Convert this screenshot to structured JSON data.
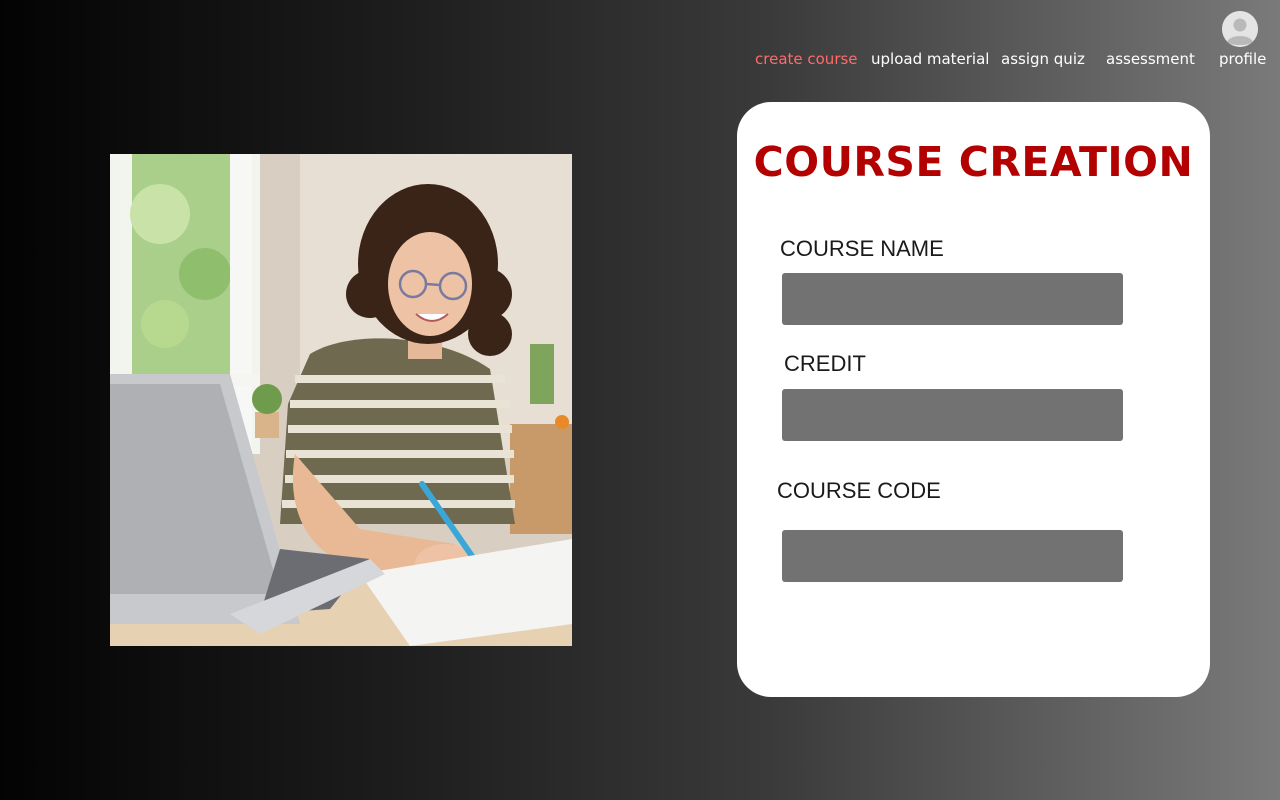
{
  "nav": {
    "items": [
      {
        "label": "create course",
        "active": true
      },
      {
        "label": "upload material",
        "active": false
      },
      {
        "label": "assign quiz",
        "active": false
      },
      {
        "label": "assessment",
        "active": false
      },
      {
        "label": "profile",
        "active": false
      }
    ]
  },
  "form": {
    "title": "COURSE CREATION",
    "fields": [
      {
        "label": "COURSE NAME",
        "value": ""
      },
      {
        "label": "CREDIT",
        "value": ""
      },
      {
        "label": "COURSE CODE",
        "value": ""
      }
    ]
  },
  "colors": {
    "accent_active": "#ff6b6b",
    "title": "#b30000",
    "input_fill": "#727272",
    "card_bg": "#ffffff"
  },
  "icons": {
    "profile": "user-avatar-icon"
  }
}
